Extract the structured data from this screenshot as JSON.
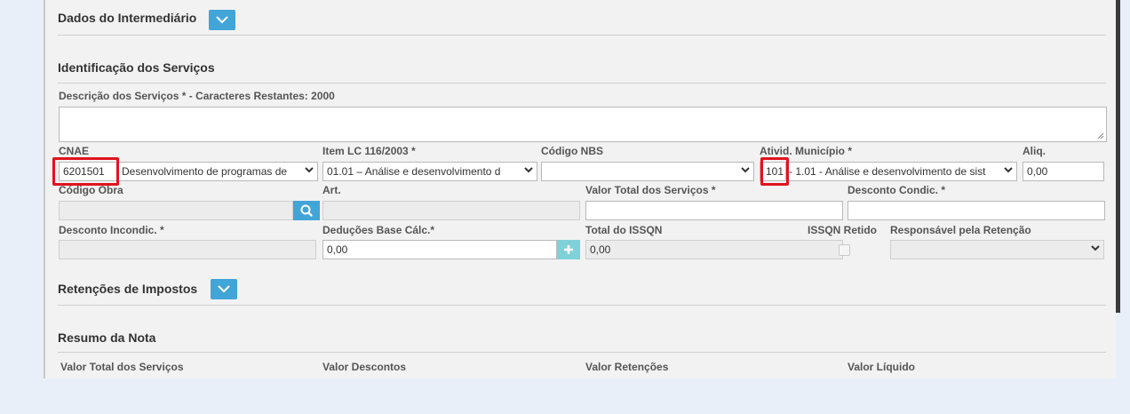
{
  "sections": {
    "intermediario": "Dados do Intermediário",
    "servicos": "Identificação dos Serviços",
    "retencoes": "Retenções de Impostos",
    "resumo": "Resumo da Nota"
  },
  "descricao": {
    "label": "Descrição dos Serviços * - Caracteres Restantes: 2000",
    "value": ""
  },
  "row1": {
    "cnae_label": "CNAE",
    "cnae_code": "6201501",
    "cnae_select": "Desenvolvimento de programas de",
    "item_lc_label": "Item LC 116/2003 *",
    "item_lc_select": "01.01 – Análise e desenvolvimento d",
    "nbs_label": "Código NBS",
    "nbs_select": "",
    "ativid_label": "Ativid. Município *",
    "ativid_code": "101",
    "ativid_select": "- 1.01 - Análise e desenvolvimento de sist",
    "aliq_label": "Aliq.",
    "aliq_value": "0,00"
  },
  "row2": {
    "obra_label": "Código Obra",
    "obra_value": "",
    "art_label": "Art.",
    "art_value": "",
    "valor_total_label": "Valor Total dos Serviços *",
    "valor_total_value": "",
    "desconto_cond_label": "Desconto Condic. *",
    "desconto_cond_value": ""
  },
  "row3": {
    "desconto_incond_label": "Desconto Incondic. *",
    "desconto_incond_value": "",
    "deducoes_label": "Deduções Base Cálc.*",
    "deducoes_value": "0,00",
    "total_issqn_label": "Total do ISSQN",
    "total_issqn_value": "0,00",
    "issqn_retido_label": "ISSQN Retido",
    "issqn_retido_checked": false,
    "responsavel_label": "Responsável pela Retenção",
    "responsavel_value": ""
  },
  "resumo_cols": [
    "Valor Total dos Serviços",
    "Valor Descontos",
    "Valor Retenções",
    "Valor Líquido"
  ],
  "colors": {
    "accent": "#42a5d8",
    "highlight": "#e0141d",
    "page_bg": "#e9eff8",
    "panel_bg": "#f2f2f2"
  },
  "icons": {
    "toggle": "chevron-down-icon",
    "search": "search-icon",
    "add": "plus-icon"
  }
}
